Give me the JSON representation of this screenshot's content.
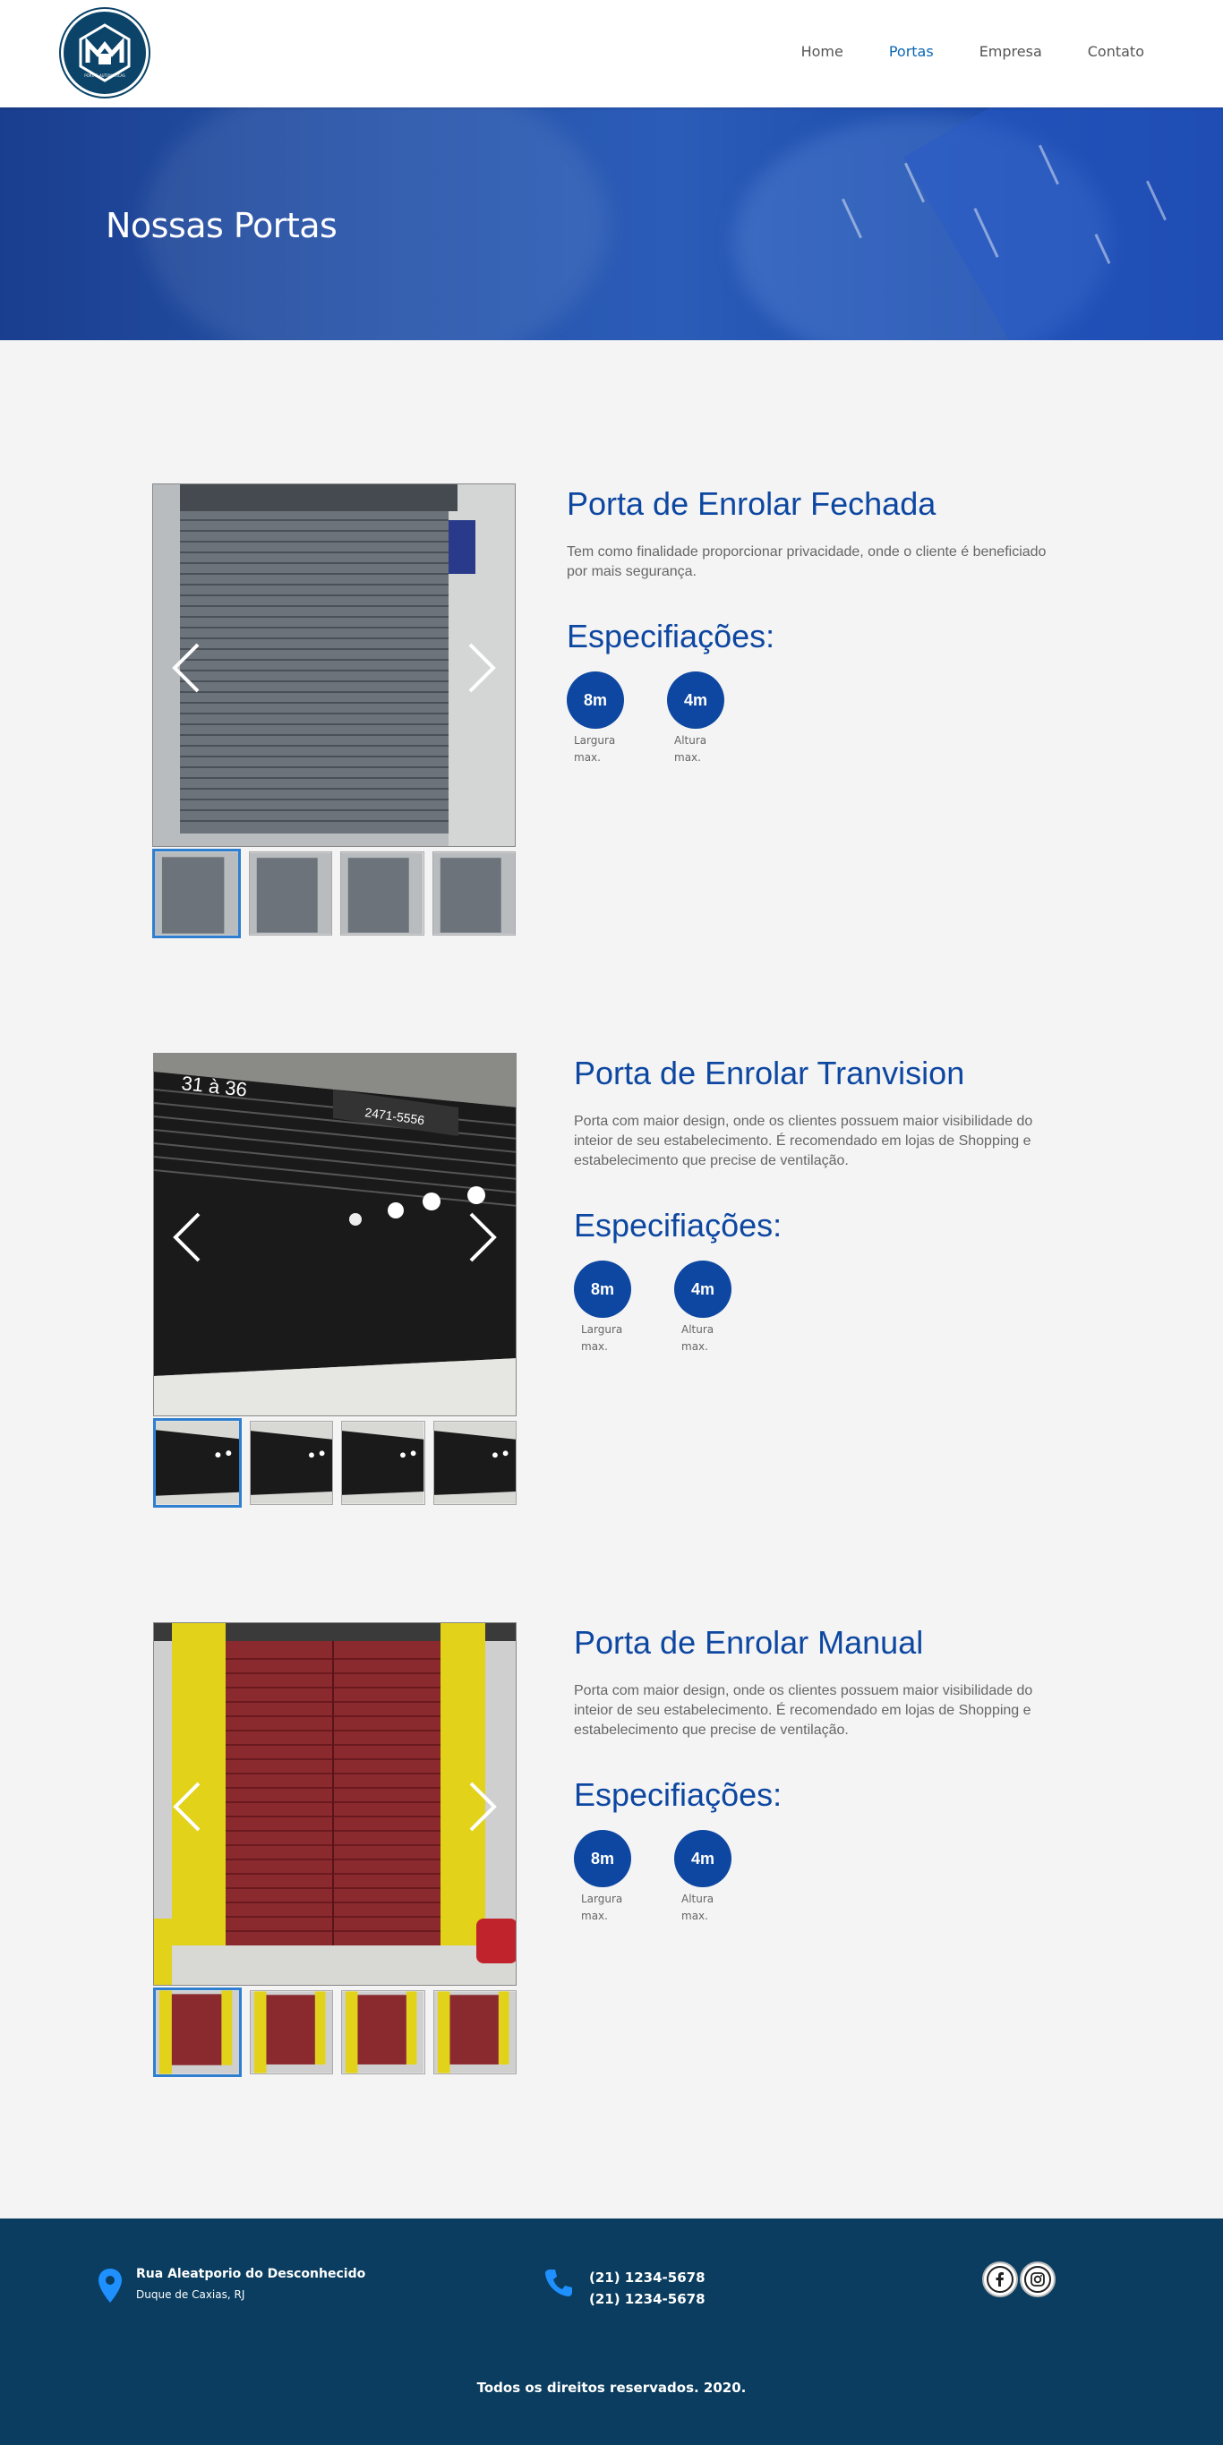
{
  "brand": {
    "logo_text": "PORTAS AUTOMÁTICAS",
    "logo_color": "#0b4468"
  },
  "nav": {
    "items": [
      {
        "label": "Home",
        "active": false
      },
      {
        "label": "Portas",
        "active": true
      },
      {
        "label": "Empresa",
        "active": false
      },
      {
        "label": "Contato",
        "active": false
      }
    ],
    "active_color": "#0b66b3"
  },
  "hero": {
    "title": "Nossas Portas"
  },
  "products": [
    {
      "title": "Porta de Enrolar Fechada",
      "description": "Tem como finalidade proporcionar privacidade, onde o cliente é beneficiado por mais segurança.",
      "specs_title": "Especifiações:",
      "specs": [
        {
          "value": "8m",
          "label_line1": "Largura",
          "label_line2": "max."
        },
        {
          "value": "4m",
          "label_line1": "Altura",
          "label_line2": "max."
        }
      ],
      "image_kind": "grey-shutter",
      "thumb_count": 4
    },
    {
      "title": "Porta de Enrolar Tranvision",
      "description": "Porta com maior design, onde os clientes possuem maior visibilidade do inteior de seu estabelecimento. É recomendado em lojas de Shopping e estabelecimento que precise de ventilação.",
      "specs_title": "Especifiações:",
      "specs": [
        {
          "value": "8m",
          "label_line1": "Largura",
          "label_line2": "max."
        },
        {
          "value": "4m",
          "label_line1": "Altura",
          "label_line2": "max."
        }
      ],
      "image_kind": "black-shutter",
      "image_sign": "2471-5556",
      "image_sign2": "31 à 36",
      "thumb_count": 4
    },
    {
      "title": "Porta de Enrolar Manual",
      "description": "Porta com maior design, onde os clientes possuem maior visibilidade do inteior de seu estabelecimento. É recomendado em lojas de Shopping e estabelecimento que precise de ventilação.",
      "specs_title": "Especifiações:",
      "specs": [
        {
          "value": "8m",
          "label_line1": "Largura",
          "label_line2": "max."
        },
        {
          "value": "4m",
          "label_line1": "Altura",
          "label_line2": "max."
        }
      ],
      "image_kind": "red-shutter",
      "thumb_count": 4
    }
  ],
  "footer": {
    "address_line1": "Rua Aleatporio do Desconhecido",
    "address_line2": "Duque de Caxias, RJ",
    "phone1": "(21) 1234-5678",
    "phone2": "(21) 1234-5678",
    "social": [
      "facebook-icon",
      "instagram-icon"
    ],
    "copyright": "Todos os direitos reservados. 2020.",
    "bg_color": "#0a3d5f",
    "icon_color": "#1e90ff"
  }
}
